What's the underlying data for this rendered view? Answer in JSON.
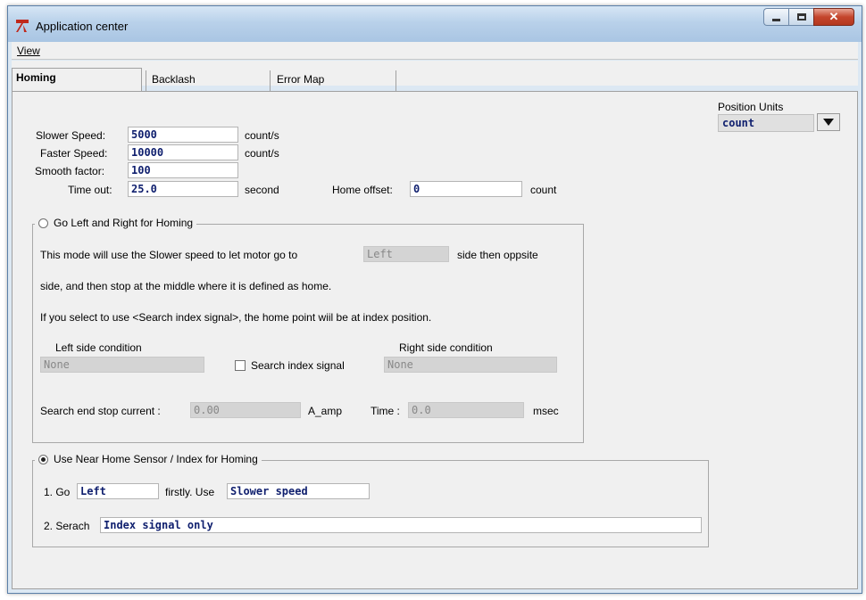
{
  "window": {
    "title": "Application center"
  },
  "menu": {
    "view_label": "View"
  },
  "tabs": [
    "Homing",
    "Backlash",
    "Error Map"
  ],
  "position_units": {
    "label": "Position Units",
    "value": "count"
  },
  "params": {
    "slower_speed": {
      "label": "Slower Speed:",
      "value": "5000",
      "unit": "count/s"
    },
    "faster_speed": {
      "label": "Faster Speed:",
      "value": "10000",
      "unit": "count/s"
    },
    "smooth_factor": {
      "label": "Smooth factor:",
      "value": "100"
    },
    "time_out": {
      "label": "Time out:",
      "value": "25.0",
      "unit": "second"
    },
    "home_offset": {
      "label": "Home offset:",
      "value": "0",
      "unit": "count"
    }
  },
  "group_left_right": {
    "title": "Go Left and Right for Homing",
    "selected": false,
    "desc_1a": "This mode will use the Slower speed to let motor go to",
    "side_value": "Left",
    "desc_1b": "side then oppsite",
    "desc_2": "side, and then stop at the middle where it is defined as home.",
    "desc_3": "If you select to use <Search index signal>, the home point wiil be at index position.",
    "left_condition_label": "Left side condition",
    "left_condition_value": "None",
    "right_condition_label": "Right side condition",
    "right_condition_value": "None",
    "search_index_label": "Search index signal",
    "search_index_checked": false,
    "end_stop_label": "Search end stop current :",
    "end_stop_value": "0.00",
    "end_stop_unit": "A_amp",
    "time_label": "Time :",
    "time_value": "0.0",
    "time_unit": "msec"
  },
  "group_sensor": {
    "title": "Use Near Home Sensor / Index for Homing",
    "selected": true,
    "go_label": "1. Go",
    "go_value": "Left",
    "firstly_label": "firstly. Use",
    "speed_value": "Slower speed",
    "search_label": "2. Serach",
    "search_value": "Index signal only"
  }
}
